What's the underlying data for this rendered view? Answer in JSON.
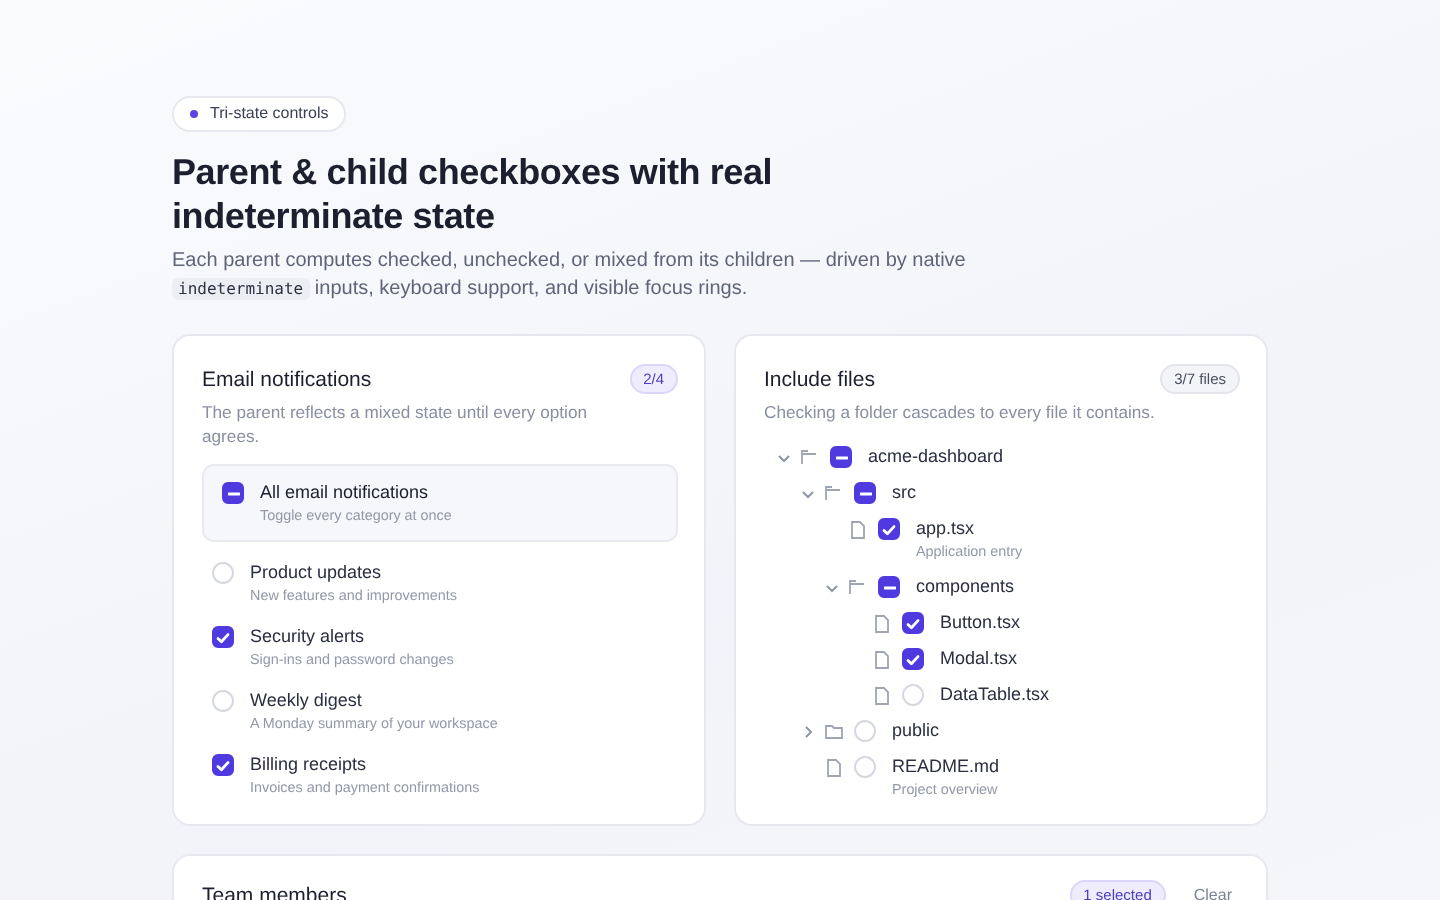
{
  "eyebrow": {
    "label": "Tri-state controls"
  },
  "heading": "Parent & child checkboxes with real indeterminate state",
  "intro": [
    {
      "kind": "text",
      "text": "Each parent computes checked, unchecked, or mixed from its children — driven by native"
    },
    {
      "kind": "code",
      "text": "indeterminate"
    },
    {
      "kind": "text",
      "text": "inputs, keyboard support, and visible focus rings."
    }
  ],
  "email_card": {
    "title": "Email notifications",
    "count": "2/4",
    "description": "The parent reflects a mixed state until every option agrees.",
    "parent": {
      "label": "All email notifications",
      "hint": "Toggle every category at once",
      "checked": false,
      "mixed": true
    },
    "options": [
      {
        "label": "Product updates",
        "hint": "New features and improvements",
        "checked": false
      },
      {
        "label": "Security alerts",
        "hint": "Sign-ins and password changes",
        "checked": true
      },
      {
        "label": "Weekly digest",
        "hint": "A Monday summary of your workspace",
        "checked": false
      },
      {
        "label": "Billing receipts",
        "hint": "Invoices and payment confirmations",
        "checked": true
      }
    ]
  },
  "files_card": {
    "title": "Include files",
    "count": "3/7 files",
    "description": "Checking a folder cascades to every file it contains.",
    "tree": [
      {
        "kind": "folder",
        "label": "acme-dashboard",
        "expanded": true,
        "checked": false,
        "mixed": true,
        "children": [
          {
            "kind": "folder",
            "label": "src",
            "expanded": true,
            "checked": false,
            "mixed": true,
            "children": [
              {
                "kind": "file",
                "label": "app.tsx",
                "hint": "Application entry",
                "checked": true,
                "mixed": false
              },
              {
                "kind": "folder",
                "label": "components",
                "expanded": true,
                "checked": false,
                "mixed": true,
                "children": [
                  {
                    "kind": "file",
                    "label": "Button.tsx",
                    "checked": true,
                    "mixed": false
                  },
                  {
                    "kind": "file",
                    "label": "Modal.tsx",
                    "checked": true,
                    "mixed": false
                  },
                  {
                    "kind": "file",
                    "label": "DataTable.tsx",
                    "checked": false,
                    "mixed": false
                  }
                ]
              }
            ]
          },
          {
            "kind": "folder",
            "label": "public",
            "expanded": false,
            "checked": false,
            "mixed": false
          },
          {
            "kind": "file",
            "label": "README.md",
            "hint": "Project overview",
            "checked": false,
            "mixed": false
          }
        ]
      }
    ]
  },
  "team_card": {
    "title": "Team members",
    "selection": "1 selected",
    "clear": "Clear"
  }
}
